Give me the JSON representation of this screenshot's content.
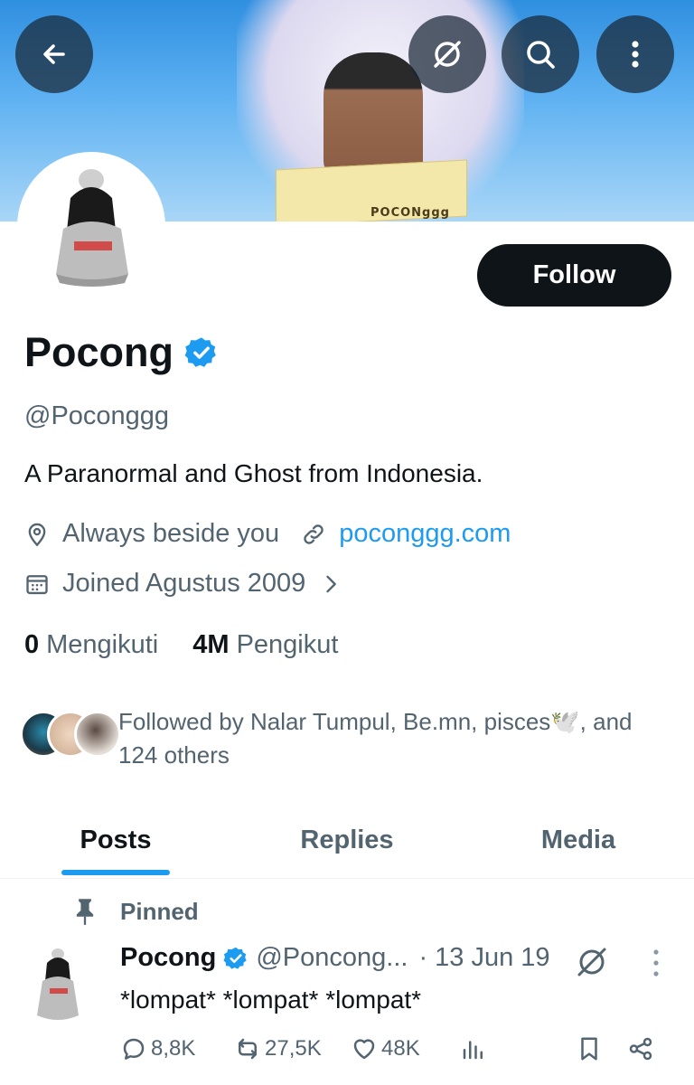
{
  "header": {
    "back_icon": "arrow-left-icon",
    "grok_icon": "grok-icon",
    "search_icon": "search-icon",
    "more_icon": "more-vertical-icon",
    "banner_book_title": "POCONggg"
  },
  "profile": {
    "follow_label": "Follow",
    "name": "Pocong",
    "handle": "@Poconggg",
    "bio": "A Paranormal and Ghost from Indonesia.",
    "location": "Always beside you",
    "website": "poconggg.com",
    "joined": "Joined Agustus 2009",
    "following_count": "0",
    "following_label": "Mengikuti",
    "followers_count": "4M",
    "followers_label": "Pengikut",
    "followed_by": "Followed by Nalar Tumpul, Be.mn, pisces🕊️, and 124 others"
  },
  "tabs": [
    {
      "label": "Posts",
      "active": true
    },
    {
      "label": "Replies",
      "active": false
    },
    {
      "label": "Media",
      "active": false
    }
  ],
  "pinned_post": {
    "pinned_label": "Pinned",
    "author_name": "Pocong",
    "author_handle": "@Poncong...",
    "date": "· 13 Jun 19",
    "text": "*lompat* *lompat* *lompat*",
    "replies": "8,8K",
    "reposts": "27,5K",
    "likes": "48K"
  },
  "colors": {
    "accent": "#1d9bf0",
    "text_primary": "#0f1419",
    "text_secondary": "#536471",
    "follow_button_bg": "#0f1419"
  }
}
